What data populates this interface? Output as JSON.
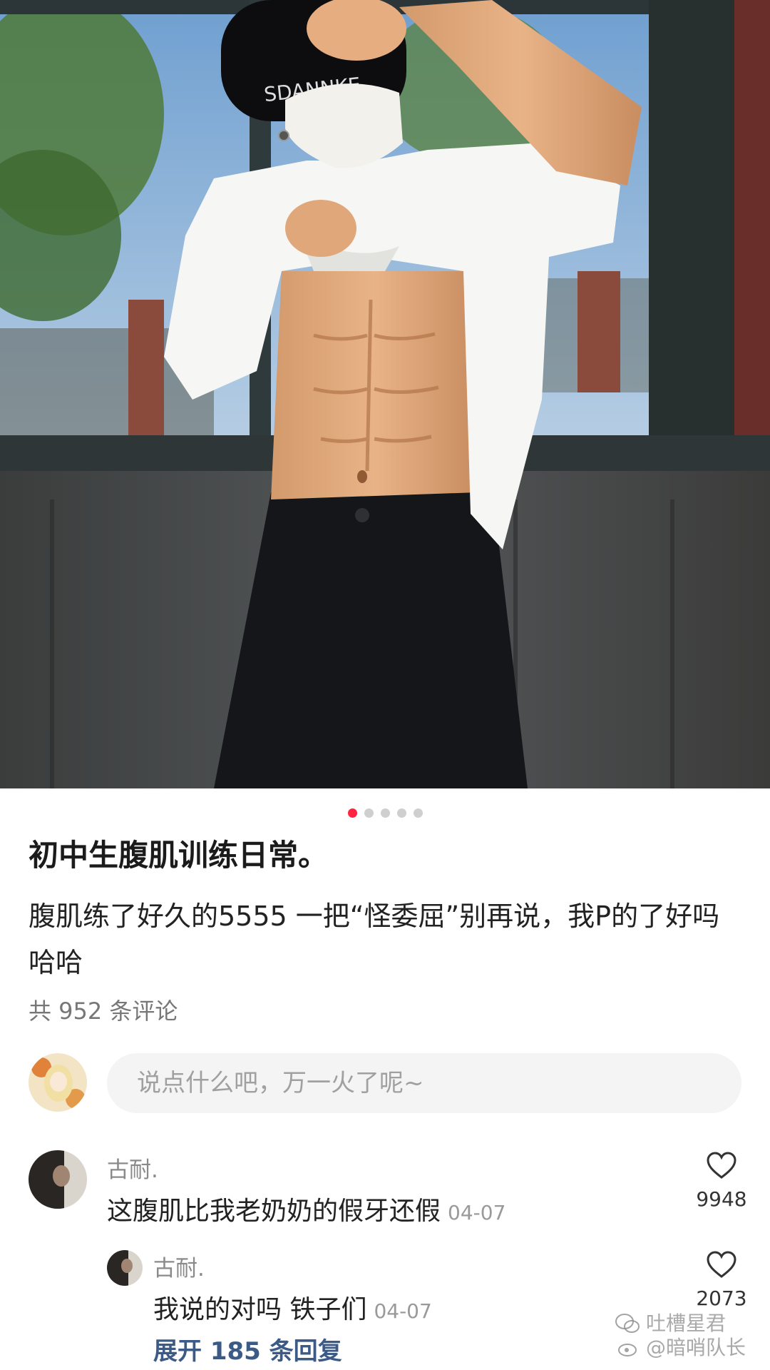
{
  "gallery": {
    "total_images": 5,
    "active_index": 0,
    "shirt_text": "SDANNKE"
  },
  "post": {
    "title": "初中生腹肌训练日常。",
    "body": "腹肌练了好久的5555 一把“怪委屈”别再说，我P的了好吗哈哈",
    "comment_count": "共 952 条评论"
  },
  "comment_input": {
    "placeholder": "说点什么吧，万一火了呢~"
  },
  "comments": [
    {
      "user": "古耐.",
      "text": "这腹肌比我老奶奶的假牙还假",
      "date": "04-07",
      "likes": "9948"
    }
  ],
  "replies": [
    {
      "user": "古耐.",
      "text": "我说的对吗 铁子们",
      "date": "04-07",
      "likes": "2073"
    }
  ],
  "expand_replies": "展开 185 条回复",
  "watermark": {
    "line1": "吐槽星君",
    "line2": "@暗哨队长"
  },
  "colors": {
    "accent": "#ff2442",
    "link": "#3b5a86"
  }
}
